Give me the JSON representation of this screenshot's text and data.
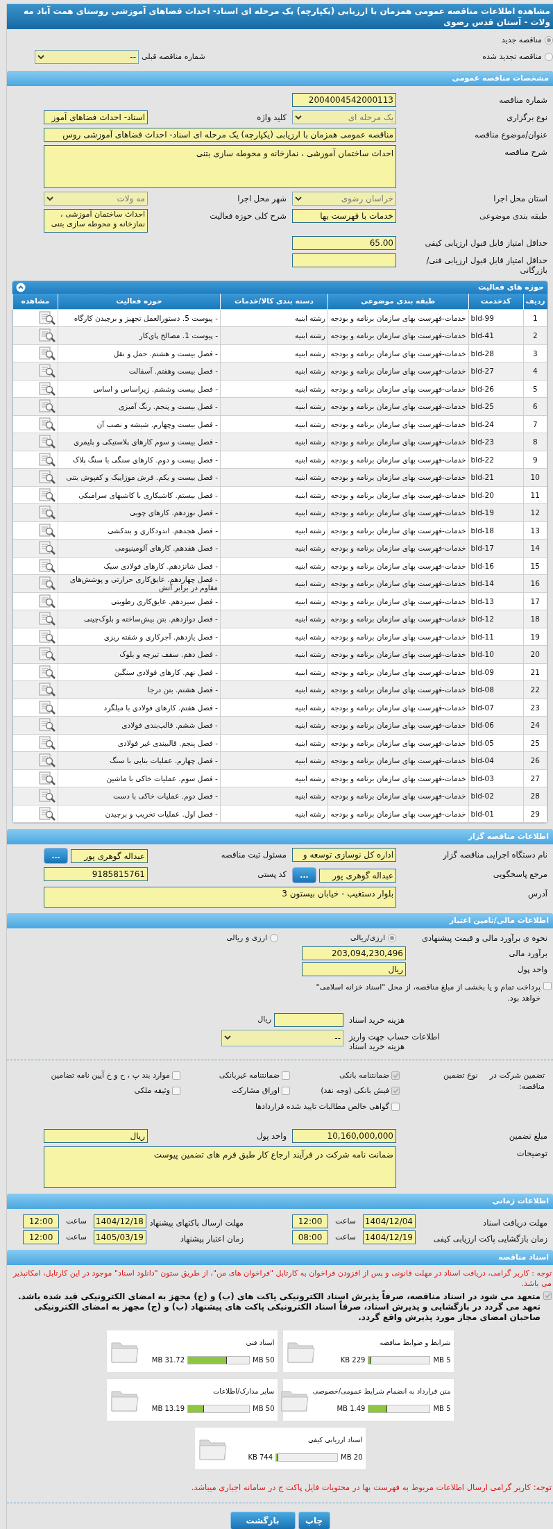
{
  "title": "مشاهده اطلاعات مناقصه عمومی همزمان با ارزیابی (یکپارچه) یک مرحله ای اسناد- احداث فضاهای آموزشی روستای همت آباد مه ولات - آستان قدس رضوی",
  "tender_status": [
    {
      "label": "مناقصه جدید",
      "selected": true
    },
    {
      "label": "مناقصه تجدید شده",
      "selected": false
    }
  ],
  "previous_tender": {
    "label": "شماره مناقصه قبلی",
    "value": "--",
    "disabled": false
  },
  "general": {
    "header": "مشخصات مناقصه عمومی",
    "rows": [
      [
        {
          "label": "شماره مناقصه",
          "kind": "text",
          "value": "2004004542000113"
        }
      ],
      [
        {
          "label": "نوع برگزاری",
          "kind": "select",
          "value": "یک مرحله ای",
          "disabled": true
        },
        {
          "label": "کلید واژه",
          "kind": "text",
          "value": "اسناد- احداث فضاهای آموز"
        }
      ],
      [
        {
          "label": "عنوان/موضوع مناقصه",
          "kind": "wide",
          "value": "مناقصه عمومی همزمان با ارزیابی (یکپارچه) یک مرحله ای اسناد- احداث فضاهای آموزشی روس"
        }
      ],
      [
        {
          "label": "شرح مناقصه",
          "kind": "textarea",
          "value": "احداث ساختمان آموزشی ، نمازخانه و محوطه سازی بتنی"
        }
      ],
      [
        {
          "label": "استان محل اجرا",
          "kind": "select",
          "value": "خراسان رضوی",
          "disabled": true
        },
        {
          "label": "شهر محل اجرا",
          "kind": "select",
          "value": "مه ولات",
          "disabled": true
        }
      ],
      [
        {
          "label": "طبقه بندی موضوعی",
          "kind": "text",
          "value": "خدمات با فهرست بها"
        },
        {
          "label": "شرح کلی حوزه فعالیت",
          "kind": "note",
          "value": "احداث ساختمان آموزشی ، نمازخانه و محوطه سازی بتنی"
        }
      ],
      [
        {
          "label": "حداقل امتیاز قابل قبول ارزیابی کیفی",
          "kind": "text",
          "value": "65.00"
        }
      ],
      [
        {
          "label": "حداقل امتیاز قابل قبول ارزیابی فنی/بازرگانی",
          "kind": "text"
        }
      ]
    ]
  },
  "activities": {
    "header": "حوزه های فعالیت",
    "expanded": true,
    "columns": [
      "ردیف",
      "کدخدمت",
      "طبقه بندی موضوعی",
      "دسته بندی کالا/خدمات",
      "حوزه فعالیت",
      "مشاهده"
    ],
    "rows": [
      {
        "row": "1",
        "code": "bld-99",
        "category": "خدمات-فهرست بهای سازمان برنامه و بودجه",
        "group": "رشته ابنیه",
        "activity": "- پیوست 5. دستورالعمل تجهیز و برچیدن کارگاه"
      },
      {
        "row": "2",
        "code": "bld-41",
        "category": "خدمات-فهرست بهای سازمان برنامه و بودجه",
        "group": "رشته ابنیه",
        "activity": "- پیوست 1. مصالح پای‌کار"
      },
      {
        "row": "3",
        "code": "bld-28",
        "category": "خدمات-فهرست بهای سازمان برنامه و بودجه",
        "group": "رشته ابنیه",
        "activity": "- فصل بیست و هشتم. حمل و نقل"
      },
      {
        "row": "4",
        "code": "bld-27",
        "category": "خدمات-فهرست بهای سازمان برنامه و بودجه",
        "group": "رشته ابنیه",
        "activity": "- فصل بیست وهفتم. آسفالت"
      },
      {
        "row": "5",
        "code": "bld-26",
        "category": "خدمات-فهرست بهای سازمان برنامه و بودجه",
        "group": "رشته ابنیه",
        "activity": "- فصل بیست وششم. زیراساس و اساس"
      },
      {
        "row": "6",
        "code": "bld-25",
        "category": "خدمات-فهرست بهای سازمان برنامه و بودجه",
        "group": "رشته ابنیه",
        "activity": "- فصل بیست و پنجم. رنگ آمیزی"
      },
      {
        "row": "7",
        "code": "bld-24",
        "category": "خدمات-فهرست بهای سازمان برنامه و بودجه",
        "group": "رشته ابنیه",
        "activity": "- فصل بیست وچهارم. شیشه و نصب آن"
      },
      {
        "row": "8",
        "code": "bld-23",
        "category": "خدمات-فهرست بهای سازمان برنامه و بودجه",
        "group": "رشته ابنیه",
        "activity": "- فصل بیست و سوم کارهای پلاستیکی و پلیمری"
      },
      {
        "row": "9",
        "code": "bld-22",
        "category": "خدمات-فهرست بهای سازمان برنامه و بودجه",
        "group": "رشته ابنیه",
        "activity": "- فصل بیست و دوم. کارهای سنگی با سنگ پلاک"
      },
      {
        "row": "10",
        "code": "bld-21",
        "category": "خدمات-فهرست بهای سازمان برنامه و بودجه",
        "group": "رشته ابنیه",
        "activity": "- فصل بیست و یکم. فرش موزاییک و کفپوش بتنی"
      },
      {
        "row": "11",
        "code": "bld-20",
        "category": "خدمات-فهرست بهای سازمان برنامه و بودجه",
        "group": "رشته ابنیه",
        "activity": "- فصل بیستم. کاشیکاری با کاشیهای سرامیکی"
      },
      {
        "row": "12",
        "code": "bld-19",
        "category": "خدمات-فهرست بهای سازمان برنامه و بودجه",
        "group": "رشته ابنیه",
        "activity": "- فصل نوزدهم. کارهای چوبی"
      },
      {
        "row": "13",
        "code": "bld-18",
        "category": "خدمات-فهرست بهای سازمان برنامه و بودجه",
        "group": "رشته ابنیه",
        "activity": "- فصل هجدهم. اندودکاری و بندکشی"
      },
      {
        "row": "14",
        "code": "bld-17",
        "category": "خدمات-فهرست بهای سازمان برنامه و بودجه",
        "group": "رشته ابنیه",
        "activity": "- فصل هفدهم. کارهای آلومینیومی"
      },
      {
        "row": "15",
        "code": "bld-16",
        "category": "خدمات-فهرست بهای سازمان برنامه و بودجه",
        "group": "رشته ابنیه",
        "activity": "- فصل شانزدهم. کارهای فولادی سبک"
      },
      {
        "row": "16",
        "code": "bld-14",
        "category": "خدمات-فهرست بهای سازمان برنامه و بودجه",
        "group": "رشته ابنیه",
        "activity": "- فصل چهاردهم. عایق‌کاری حرارتی و پوشش‌های مقاوم در برابر آتش"
      },
      {
        "row": "17",
        "code": "bld-13",
        "category": "خدمات-فهرست بهای سازمان برنامه و بودجه",
        "group": "رشته ابنیه",
        "activity": "- فصل سیزدهم. عایق‌کاری رطوبتی"
      },
      {
        "row": "18",
        "code": "bld-12",
        "category": "خدمات-فهرست بهای سازمان برنامه و بودجه",
        "group": "رشته ابنیه",
        "activity": "- فصل دوازدهم. بتن پیش‌ساخته و بلوک‌چینی"
      },
      {
        "row": "19",
        "code": "bld-11",
        "category": "خدمات-فهرست بهای سازمان برنامه و بودجه",
        "group": "رشته ابنیه",
        "activity": "- فصل یازدهم. آجرکاری و شفته ریزی"
      },
      {
        "row": "20",
        "code": "bld-10",
        "category": "خدمات-فهرست بهای سازمان برنامه و بودجه",
        "group": "رشته ابنیه",
        "activity": "- فصل دهم. سقف تیرچه و بلوک"
      },
      {
        "row": "21",
        "code": "bld-09",
        "category": "خدمات-فهرست بهای سازمان برنامه و بودجه",
        "group": "رشته ابنیه",
        "activity": "- فصل نهم. کارهای فولادی سنگین"
      },
      {
        "row": "22",
        "code": "bld-08",
        "category": "خدمات-فهرست بهای سازمان برنامه و بودجه",
        "group": "رشته ابنیه",
        "activity": "- فصل هشتم. بتن درجا"
      },
      {
        "row": "23",
        "code": "bld-07",
        "category": "خدمات-فهرست بهای سازمان برنامه و بودجه",
        "group": "رشته ابنیه",
        "activity": "- فصل هفتم. کارهای فولادی با میلگرد"
      },
      {
        "row": "24",
        "code": "bld-06",
        "category": "خدمات-فهرست بهای سازمان برنامه و بودجه",
        "group": "رشته ابنیه",
        "activity": "- فصل ششم. قالب‌بندی فولادی"
      },
      {
        "row": "25",
        "code": "bld-05",
        "category": "خدمات-فهرست بهای سازمان برنامه و بودجه",
        "group": "رشته ابنیه",
        "activity": "- فصل پنجم. قالببندی غیر فولادی"
      },
      {
        "row": "26",
        "code": "bld-04",
        "category": "خدمات-فهرست بهای سازمان برنامه و بودجه",
        "group": "رشته ابنیه",
        "activity": "- فصل چهارم. عملیات بنایی با سنگ"
      },
      {
        "row": "27",
        "code": "bld-03",
        "category": "خدمات-فهرست بهای سازمان برنامه و بودجه",
        "group": "رشته ابنیه",
        "activity": "- فصل سوم. عملیات خاکی با ماشین"
      },
      {
        "row": "28",
        "code": "bld-02",
        "category": "خدمات-فهرست بهای سازمان برنامه و بودجه",
        "group": "رشته ابنیه",
        "activity": "- فصل دوم. عملیات خاکی با دست"
      },
      {
        "row": "29",
        "code": "bld-01",
        "category": "خدمات-فهرست بهای سازمان برنامه و بودجه",
        "group": "رشته ابنیه",
        "activity": "- فصل اول. عملیات تخریب و برچیدن"
      }
    ]
  },
  "organizer": {
    "header": "اطلاعات مناقصه گزار",
    "rows": [
      [
        {
          "label": "نام دستگاه اجرایی مناقصه گزار",
          "kind": "text",
          "value": "اداره کل نوسازی  توسعه و"
        },
        {
          "label": "مسئول ثبت مناقصه",
          "kind": "text",
          "value": "عبداله گوهری پور",
          "button": "..."
        }
      ],
      [
        {
          "label": "مرجع پاسخگویی",
          "kind": "text",
          "value": "عبداله گوهری پور",
          "button": "..."
        },
        {
          "label": "کد پستی",
          "kind": "text",
          "value": "9185815761"
        }
      ],
      [
        {
          "label": "آدرس",
          "kind": "address",
          "value": "بلوار دستغیب - خیابان بیستون 3"
        }
      ]
    ]
  },
  "finance": {
    "header": "اطلاعات مالی/تامین اعتبار",
    "estimate": {
      "label": "نحوه ی برآورد مالی و قیمت پیشنهادی",
      "options": [
        {
          "label": "ارزی/ریالی",
          "selected": true
        },
        {
          "label": "ارزی و ریالی",
          "selected": false
        }
      ]
    },
    "rows": [
      [
        {
          "label": "برآورد مالی",
          "kind": "text",
          "value": "203,094,230,496"
        }
      ],
      [
        {
          "label": "واحد پول",
          "kind": "text",
          "value": "ریال"
        }
      ]
    ],
    "treasury": {
      "label": "پرداخت تمام و یا بخشی از مبلغ مناقصه، از محل \"اسناد خزانه اسلامی\" خواهد بود.",
      "checked": false
    },
    "doc_rows": [
      {
        "label": "هزینه خرید اسناد",
        "kind": "text",
        "suffix": "ریال"
      },
      {
        "label": "اطلاعات حساب جهت واریز هزینه خرید اسناد",
        "kind": "select",
        "value": "--",
        "disabled": false
      }
    ],
    "guarantee": {
      "label": "تضمین شرکت در مناقصه:",
      "type_label": "نوع تضمین",
      "options": [
        {
          "label": "ضمانتنامه بانکی",
          "checked": true
        },
        {
          "label": "ضمانتنامه غیربانکی",
          "checked": false
        },
        {
          "label": "موارد بند پ ، ح و خ آیین نامه تضامین",
          "checked": false
        },
        {
          "label": "فیش بانکی (وجه نقد)",
          "checked": true
        },
        {
          "label": "اوراق مشارکت",
          "checked": false
        },
        {
          "label": "وثیقه ملکی",
          "checked": false
        },
        {
          "label": "گواهی خالص مطالبات تایید شده قراردادها",
          "checked": false
        }
      ]
    },
    "guarantee_rows": [
      [
        {
          "label": "مبلغ تضمین",
          "kind": "text",
          "value": "10,160,000,000"
        },
        {
          "label": "واحد پول",
          "kind": "text",
          "value": "ریال"
        }
      ],
      [
        {
          "label": "توضیحات",
          "kind": "textarea",
          "value": "ضمانت نامه شرکت در فرآیند ارجاع کار طبق فرم های تضمین پیوست"
        }
      ]
    ]
  },
  "timing": {
    "header": "اطلاعات زمانی",
    "rows": [
      [
        {
          "label": "مهلت دریافت اسناد",
          "date": "1404/12/04",
          "time_label": "ساعت",
          "time": "12:00"
        },
        {
          "label": "مهلت ارسال پاکتهای پیشنهاد",
          "date": "1404/12/18",
          "time_label": "ساعت",
          "time": "12:00"
        }
      ],
      [
        {
          "label": "زمان بازگشایی پاکت ارزیابی کیفی",
          "date": "1404/12/19",
          "time_label": "ساعت",
          "time": "08:00"
        },
        {
          "label": "زمان اعتبار پیشنهاد",
          "date": "1405/03/19",
          "time_label": "ساعت",
          "time": "12:00"
        }
      ]
    ]
  },
  "documents": {
    "header": "اسناد مناقصه",
    "notice": "توجه : کاربر گرامی، دریافت اسناد در مهلت قانونی و پس از افزودن فراخوان به کارتابل \"فراخوان های من\"، از طریق ستون \"دانلود اسناد\" موجود در این کارتابل، امکانپذیر می باشد.",
    "commitment": {
      "text": "متعهد می شود در اسناد مناقصه، صرفاً پذیرش اسناد الکترونیکی پاکت های (ب) و (ج) مجهز به امضای الکترونیکی قید شده باشد. تعهد می گردد در بازگشایی و پذیرش اسناد، صرفاً اسناد الکترونیکی پاکت های پیشنهاد (ب) و (ج) مجهز به امضای الکترونیکی صاحبان امضای مجاز مورد پذیرش واقع گردد.",
      "checked": true
    },
    "files": [
      {
        "name": "شرایط و ضوابط مناقصه",
        "used": "229 KB",
        "max": "5 MB",
        "level": 0.045
      },
      {
        "name": "اسناد فنی",
        "used": "31.72 MB",
        "max": "50 MB",
        "level": 0.634
      },
      {
        "name": "متن قرارداد به انضمام شرایط عمومی/خصوصی",
        "used": "1.49 MB",
        "max": "5 MB",
        "level": 0.298
      },
      {
        "name": "سایر مدارک/اطلاعات",
        "used": "13.19 MB",
        "max": "50 MB",
        "level": 0.264
      },
      {
        "name": "اسناد ارزیابی کیفی",
        "used": "744 KB",
        "max": "20 MB",
        "level": 0.036
      }
    ],
    "footer_note": "توجه: کاربر گرامی ارسال اطلاعات مربوط به فهرست بها در محتویات فایل پاکت ج در سامانه اجباری میباشد."
  },
  "buttons": [
    "چاپ",
    "بازگشت"
  ]
}
